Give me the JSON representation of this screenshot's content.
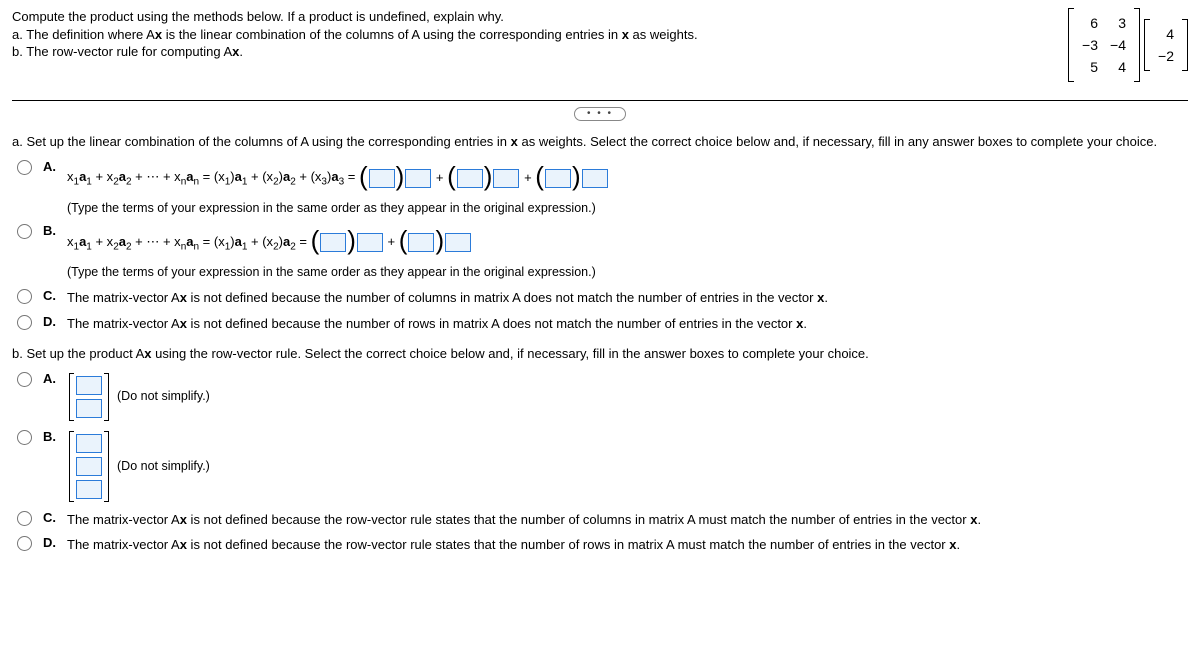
{
  "header": {
    "line1": "Compute the product using the methods below. If a product is undefined, explain why.",
    "line2_pre": "a. The definition where A",
    "line2_mid": " is the linear combination of the columns of A using the corresponding entries in ",
    "line2_post": " as weights.",
    "line3": "b. The row-vector rule for computing A",
    "line3_post": "."
  },
  "matrixA": [
    [
      "6",
      "3"
    ],
    [
      "−3",
      "−4"
    ],
    [
      "5",
      "4"
    ]
  ],
  "vectorX": [
    [
      "4"
    ],
    [
      "−2"
    ]
  ],
  "dots": "• • •",
  "partA": {
    "prompt_pre": "a. Set up the linear combination of the columns of A using the corresponding entries in ",
    "prompt_post": " as weights. Select the correct choice below and, if necessary, fill in any answer boxes to complete your choice.",
    "choiceA_formula": "x₁a₁ + x₂a₂ + ⋯ + xₙaₙ = (x₁)a₁ + (x₂)a₂ + (x₃)a₃ =",
    "hint": "(Type the terms of your expression in the same order as they appear in the original expression.)",
    "choiceB_formula": "x₁a₁ + x₂a₂ + ⋯ + xₙaₙ = (x₁)a₁ + (x₂)a₂ =",
    "choiceC_pre": "The matrix-vector A",
    "choiceC_mid": " is not defined because the number of columns in matrix A does not match the number of entries in the vector ",
    "choiceD_pre": "The matrix-vector A",
    "choiceD_mid": " is not defined because the number of rows in matrix A does not match the number of entries in the vector "
  },
  "partB": {
    "prompt_pre": "b. Set up the product A",
    "prompt_post": " using the row-vector rule. Select the correct choice below and, if necessary, fill in the answer boxes to complete your choice.",
    "simplify": "(Do not simplify.)",
    "choiceC_pre": "The matrix-vector A",
    "choiceC_mid": " is not defined because the row-vector rule states that the number of columns in matrix A must match the number of entries in the vector ",
    "choiceD_pre": "The matrix-vector A",
    "choiceD_mid": " is not defined because the row-vector rule states that the number of rows in matrix A must match the number of entries in the vector "
  },
  "labels": {
    "A": "A.",
    "B": "B.",
    "C": "C.",
    "D": "D.",
    "x": "x",
    "period": "."
  }
}
